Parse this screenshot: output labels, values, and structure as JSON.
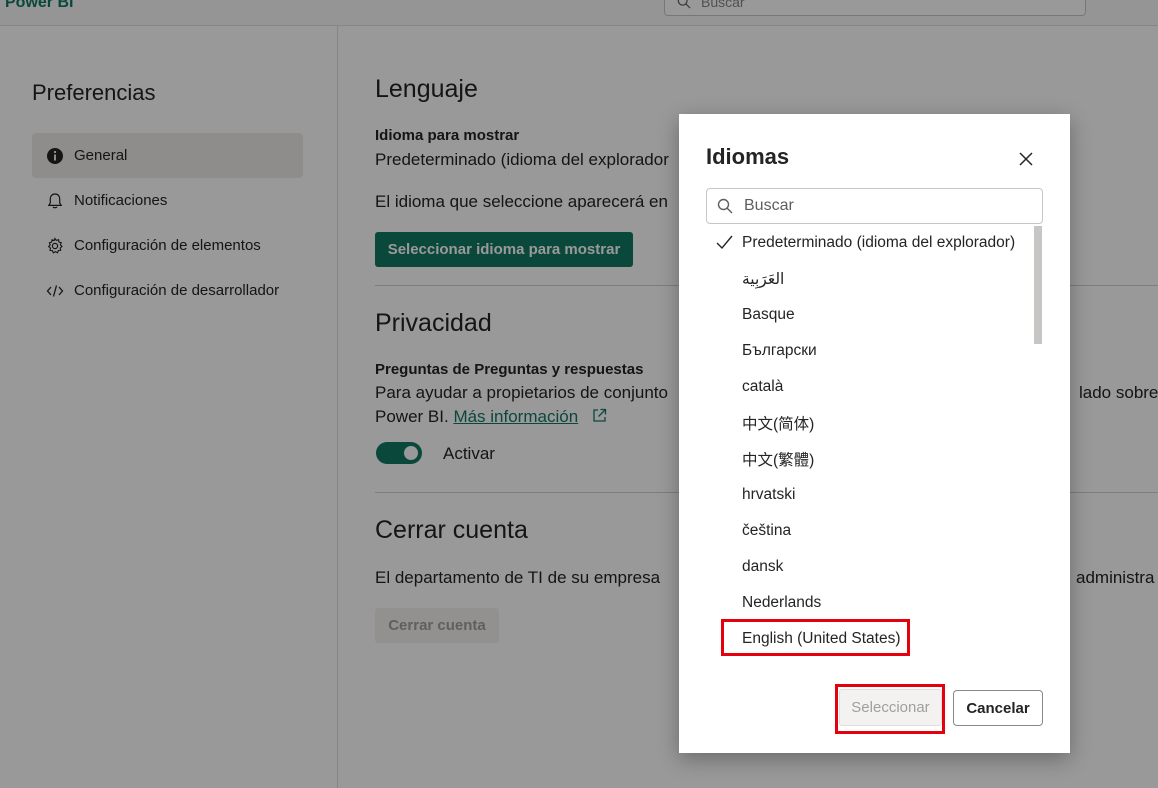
{
  "app": {
    "brand": "Power BI",
    "search_placeholder": "Buscar"
  },
  "sidebar": {
    "title": "Preferencias",
    "items": [
      {
        "label": "General",
        "icon": "info-icon",
        "active": true
      },
      {
        "label": "Notificaciones",
        "icon": "bell-icon",
        "active": false
      },
      {
        "label": "Configuración de elementos",
        "icon": "gear-icon",
        "active": false
      },
      {
        "label": "Configuración de desarrollador",
        "icon": "code-icon",
        "active": false
      }
    ]
  },
  "main": {
    "language": {
      "heading": "Lenguaje",
      "display_label": "Idioma para mostrar",
      "display_value": "Predeterminado (idioma del explorador",
      "description": "El idioma que seleccione aparecerá en",
      "button": "Seleccionar idioma para mostrar"
    },
    "privacy": {
      "heading": "Privacidad",
      "qa_label": "Preguntas de Preguntas y respuestas",
      "desc_line1_left": "Para ayudar a propietarios de conjunto",
      "desc_line1_right": "lado sobre",
      "desc_line2": "Power BI.",
      "link": "Más información",
      "toggle_label": "Activar",
      "toggle_on": true
    },
    "account": {
      "heading": "Cerrar cuenta",
      "desc_left": "El departamento de TI de su empresa",
      "desc_right": "administra",
      "button": "Cerrar cuenta"
    }
  },
  "dialog": {
    "title": "Idiomas",
    "search_placeholder": "Buscar",
    "languages": [
      {
        "label": "Predeterminado (idioma del explorador)",
        "selected": true
      },
      {
        "label": "العَرَبِية",
        "selected": false
      },
      {
        "label": "Basque",
        "selected": false
      },
      {
        "label": "Български",
        "selected": false
      },
      {
        "label": "català",
        "selected": false
      },
      {
        "label": "中文(简体)",
        "selected": false
      },
      {
        "label": "中文(繁體)",
        "selected": false
      },
      {
        "label": "hrvatski",
        "selected": false
      },
      {
        "label": "čeština",
        "selected": false
      },
      {
        "label": "dansk",
        "selected": false
      },
      {
        "label": "Nederlands",
        "selected": false
      },
      {
        "label": "English (United States)",
        "selected": false
      }
    ],
    "select_button": "Seleccionar",
    "cancel_button": "Cancelar"
  },
  "colors": {
    "accent": "#117865",
    "highlight": "#e5000d"
  }
}
